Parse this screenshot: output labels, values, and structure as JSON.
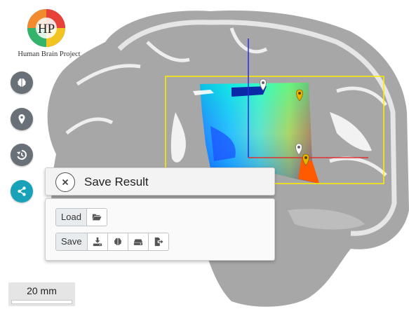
{
  "logo": {
    "monogram": "HP",
    "text": "Human Brain Project"
  },
  "toolbar": {
    "buttons": [
      {
        "icon": "brain-icon"
      },
      {
        "icon": "map-marker-icon"
      },
      {
        "icon": "history-icon"
      },
      {
        "icon": "share-icon",
        "active": true
      }
    ]
  },
  "panel": {
    "title": "Save Result",
    "load_label": "Load",
    "save_label": "Save",
    "load_icons": [
      "folder-open-icon"
    ],
    "save_icons": [
      "download-icon",
      "brain-icon",
      "hdd-icon",
      "export-icon"
    ]
  },
  "scale": {
    "label": "20 mm"
  },
  "colors": {
    "accent": "#17a2b8",
    "tool_button": "#6a7077",
    "marker_white": "#ffffff",
    "marker_yellow": "#e8b400",
    "selection": "#ffef00",
    "crosshair_blue": "#2a2ae0",
    "crosshair_red": "#e03030"
  }
}
